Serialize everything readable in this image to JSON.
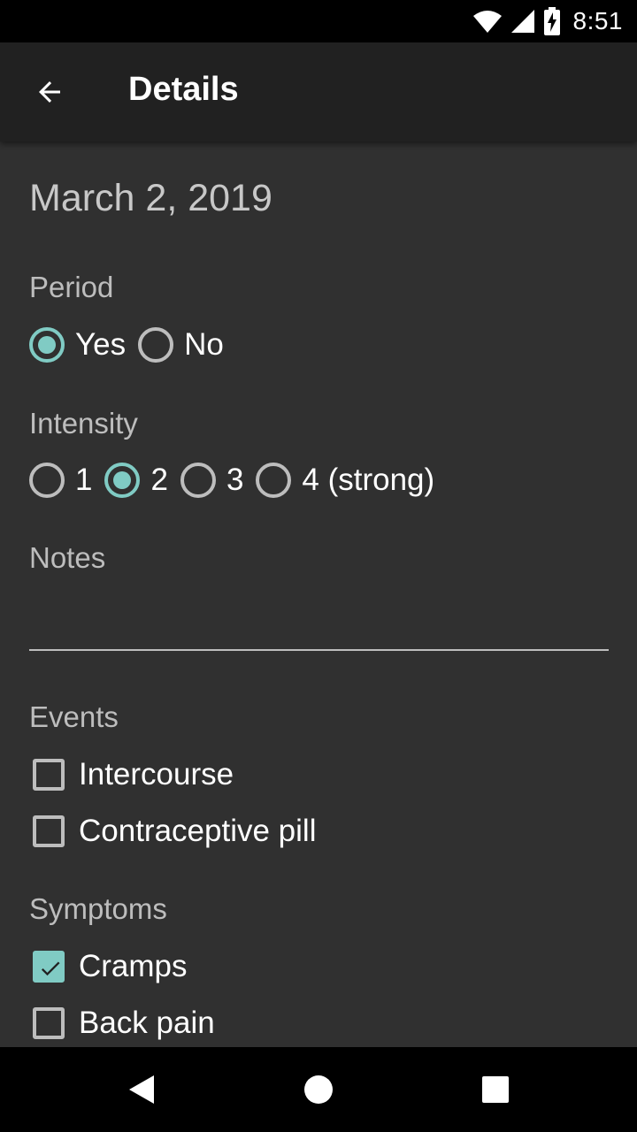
{
  "status_bar": {
    "time": "8:51",
    "icons": [
      "wifi-icon",
      "signal-icon",
      "battery-charging-icon"
    ]
  },
  "app_bar": {
    "title": "Details",
    "back_icon": "arrow-back-icon"
  },
  "date": "March 2, 2019",
  "period": {
    "label": "Period",
    "options": [
      {
        "label": "Yes",
        "selected": true
      },
      {
        "label": "No",
        "selected": false
      }
    ]
  },
  "intensity": {
    "label": "Intensity",
    "options": [
      {
        "label": "1",
        "selected": false
      },
      {
        "label": "2",
        "selected": true
      },
      {
        "label": "3",
        "selected": false
      },
      {
        "label": "4 (strong)",
        "selected": false
      }
    ]
  },
  "notes": {
    "label": "Notes",
    "value": ""
  },
  "events": {
    "label": "Events",
    "items": [
      {
        "label": "Intercourse",
        "checked": false
      },
      {
        "label": "Contraceptive pill",
        "checked": false
      }
    ]
  },
  "symptoms": {
    "label": "Symptoms",
    "items": [
      {
        "label": "Cramps",
        "checked": true
      },
      {
        "label": "Back pain",
        "checked": false
      }
    ]
  },
  "nav_bar": {
    "icons": [
      "back-triangle-icon",
      "home-circle-icon",
      "recents-square-icon"
    ]
  },
  "colors": {
    "accent": "#80cbc4",
    "background": "#303030",
    "app_bar": "#212121"
  }
}
